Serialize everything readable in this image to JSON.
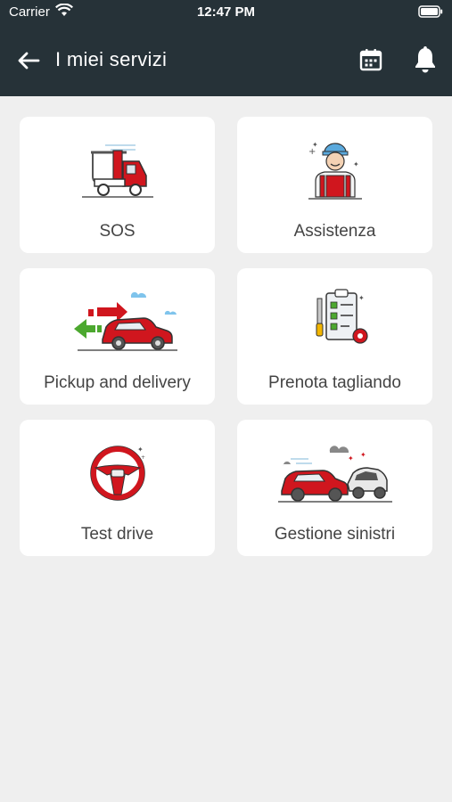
{
  "status_bar": {
    "carrier": "Carrier",
    "time": "12:47 PM"
  },
  "header": {
    "title": "I miei servizi",
    "background": "#263238"
  },
  "services": [
    {
      "label": "SOS",
      "icon": "tow-truck-icon"
    },
    {
      "label": "Assistenza",
      "icon": "mechanic-icon"
    },
    {
      "label": "Pickup and delivery",
      "icon": "pickup-delivery-car-icon"
    },
    {
      "label": "Prenota tagliando",
      "icon": "checklist-service-icon"
    },
    {
      "label": "Test drive",
      "icon": "steering-wheel-icon"
    },
    {
      "label": "Gestione sinistri",
      "icon": "car-crash-icon"
    }
  ],
  "colors": {
    "accent": "#d0161e",
    "background": "#efefef",
    "card": "#ffffff",
    "text": "#444444"
  }
}
